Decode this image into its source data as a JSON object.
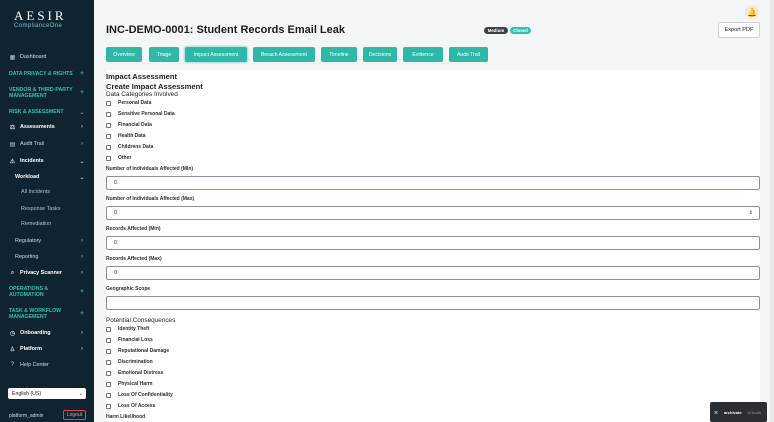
{
  "brand": {
    "name": "AESIR",
    "sub": "ComplianceOne"
  },
  "sidebar": {
    "items": [
      {
        "label": "Dashboard",
        "icon": "dashboard-icon",
        "glyph": "▦",
        "chev": "",
        "kind": "top"
      },
      {
        "label": "DATA PRIVACY & RIGHTS",
        "glyph": "",
        "chev": "+",
        "kind": "section"
      },
      {
        "label": "VENDOR & THIRD-PARTY MANAGEMENT",
        "glyph": "",
        "chev": "+",
        "kind": "section"
      },
      {
        "label": "RISK & ASSESSMENT",
        "glyph": "",
        "chev": "⌄",
        "kind": "section"
      },
      {
        "label": "Assessments",
        "icon": "assessments-icon",
        "glyph": "⚖",
        "chev": "›",
        "kind": "bold"
      },
      {
        "label": "Audit Trail",
        "icon": "audit-trail-icon",
        "glyph": "▤",
        "chev": "›",
        "kind": "top"
      },
      {
        "label": "Incidents",
        "icon": "warning-icon",
        "glyph": "⚠",
        "chev": "⌄",
        "kind": "bold"
      },
      {
        "label": "Workload",
        "glyph": "",
        "chev": "⌄",
        "kind": "sub-bold"
      },
      {
        "label": "All Incidents",
        "glyph": "",
        "chev": "",
        "kind": "sub2"
      },
      {
        "label": "Response Tasks",
        "glyph": "",
        "chev": "",
        "kind": "sub2"
      },
      {
        "label": "Remediation",
        "glyph": "",
        "chev": "",
        "kind": "sub2"
      },
      {
        "label": "Regulatory",
        "glyph": "",
        "chev": "›",
        "kind": "sub"
      },
      {
        "label": "Reporting",
        "glyph": "",
        "chev": "›",
        "kind": "sub"
      },
      {
        "label": "Privacy Scanner",
        "icon": "scanner-icon",
        "glyph": "⌕",
        "chev": "›",
        "kind": "bold"
      },
      {
        "label": "OPERATIONS & AUTOMATION",
        "glyph": "",
        "chev": "+",
        "kind": "section"
      },
      {
        "label": "TASK & WORKFLOW MANAGEMENT",
        "glyph": "",
        "chev": "+",
        "kind": "section"
      },
      {
        "label": "Onboarding",
        "icon": "onboarding-icon",
        "glyph": "◷",
        "chev": "›",
        "kind": "bold"
      },
      {
        "label": "Platform",
        "icon": "user-icon",
        "glyph": "♙",
        "chev": "›",
        "kind": "bold"
      },
      {
        "label": "Help Center",
        "icon": "help-icon",
        "glyph": "?",
        "chev": "",
        "kind": "top"
      }
    ],
    "language": "English (US)",
    "user": "platform_admin",
    "logout": "Logout"
  },
  "header": {
    "title": "INC-DEMO-0001: Student Records Email Leak",
    "badges": [
      "Medium",
      "Closed"
    ],
    "export": "Export PDF"
  },
  "tabs": [
    "Overview",
    "Triage",
    "Impact Assessment",
    "Breach Assessment",
    "Timeline",
    "Decisions",
    "Evidence",
    "Audit Trail"
  ],
  "form": {
    "heading": "Impact Assessment",
    "subheading": "Create Impact Assessment",
    "categories_title": "Data Categories Involved",
    "categories": [
      "Personal Data",
      "Sensitive Personal Data",
      "Financial Data",
      "Health Data",
      "Childrens Data",
      "Other"
    ],
    "fields": [
      {
        "label": "Number of Individuals Affected (Min)",
        "value": "0",
        "spinner": false
      },
      {
        "label": "Number of Individuals Affected (Max)",
        "value": "0",
        "spinner": true
      },
      {
        "label": "Records Affected (Min)",
        "value": "0",
        "spinner": false
      },
      {
        "label": "Records Affected (Max)",
        "value": "0",
        "spinner": false
      },
      {
        "label": "Geographic Scope",
        "value": "",
        "spinner": false
      }
    ],
    "consequences_title": "Potential Consequences",
    "consequences": [
      "Identity Theft",
      "Financial Loss",
      "Reputational Damage",
      "Discrimination",
      "Emotional Distress",
      "Physical Harm",
      "Loss Of Confidentiality",
      "Loss Of Access"
    ],
    "harm_label": "Harm Likelihood"
  },
  "toast": {
    "a": "⌘",
    "b": "archivate",
    "c": "Ω Audit"
  },
  "colors": {
    "sidebar": "#0f2430",
    "accent": "#2fb8a8",
    "section": "#2fc3b1"
  }
}
